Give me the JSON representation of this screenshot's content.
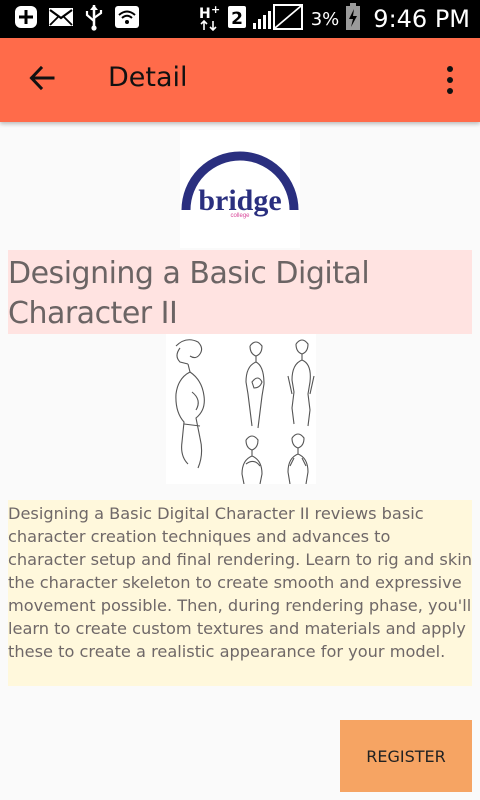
{
  "status_bar": {
    "time": "9:46 PM",
    "battery": "3%",
    "network": "2",
    "icons": [
      "add-box-icon",
      "mail-icon",
      "usb-icon",
      "wifi-icon",
      "hplus-icon",
      "sim-icon",
      "signal-icon",
      "battery-icon"
    ]
  },
  "app_bar": {
    "title": "Detail",
    "back_icon": "arrow-back-icon",
    "menu_icon": "more-vert-icon",
    "color": "#ff6b4a"
  },
  "logo": {
    "text": "bridge",
    "subtext": "college"
  },
  "course": {
    "title": "Designing a Basic Digital Character II",
    "description": "Designing a Basic Digital Character II reviews basic character creation techniques and advances to character setup and final rendering. Learn to rig and skin the character skeleton to create smooth and expressive movement possible. Then, during rendering phase, you'll learn to create custom textures and materials and apply these to create a realistic appearance for your model."
  },
  "actions": {
    "register_label": "REGISTER"
  },
  "colors": {
    "title_bg": "#ffe3e1",
    "description_bg": "#fff8dc",
    "register_bg": "#f6a463",
    "logo_navy": "#2a2f7f",
    "logo_pink": "#d8479a"
  }
}
